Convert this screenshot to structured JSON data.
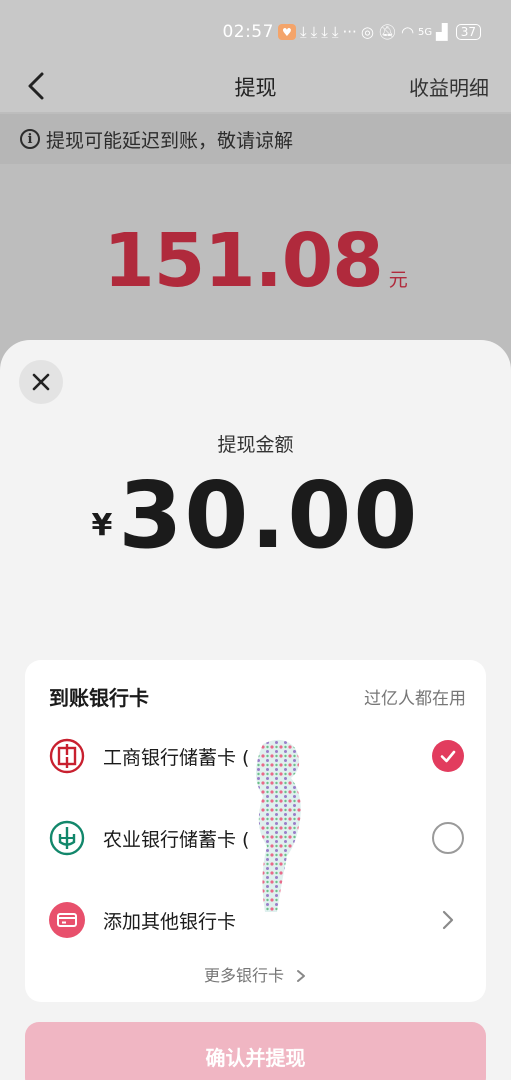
{
  "status_bar": {
    "time": "02:57",
    "network": "5G",
    "battery": "37"
  },
  "header": {
    "title": "提现",
    "detail_link": "收益明细"
  },
  "notice": {
    "text": "提现可能延迟到账，敬请谅解"
  },
  "balance": {
    "amount": "151.08",
    "unit": "元"
  },
  "sheet": {
    "amount_label": "提现金额",
    "currency": "¥",
    "amount": "30.00",
    "card": {
      "title": "到账银行卡",
      "note": "过亿人都在用",
      "banks": [
        {
          "name": "工商银行储蓄卡 (",
          "selected": true,
          "icon": "icbc-logo-icon"
        },
        {
          "name": "农业银行储蓄卡 (",
          "selected": false,
          "icon": "abc-logo-icon"
        },
        {
          "name": "添加其他银行卡",
          "selected": false,
          "icon": "card-add-icon"
        }
      ],
      "more_label": "更多银行卡"
    },
    "confirm_label": "确认并提现"
  },
  "colors": {
    "accent": "#e23c5e",
    "balance": "#b02a3c",
    "confirm_disabled": "#f0b6c3"
  }
}
